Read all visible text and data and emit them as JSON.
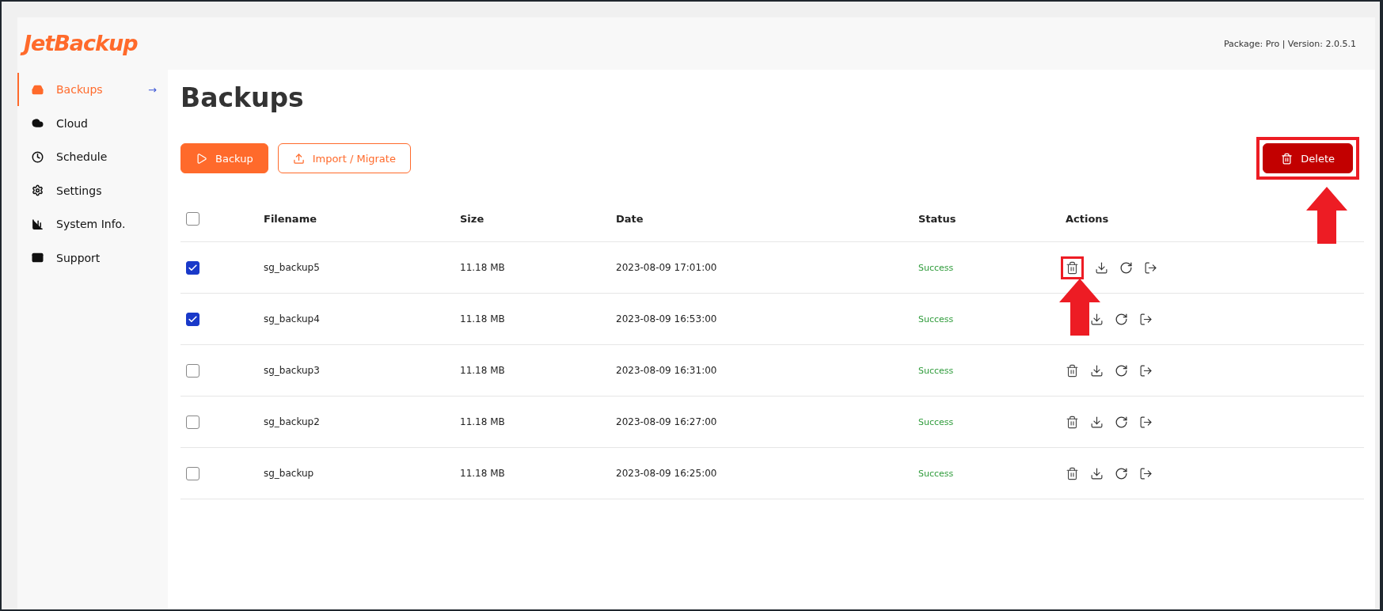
{
  "logo": "JetBackup",
  "header_info": "Package: Pro | Version: 2.0.5.1",
  "sidebar": {
    "items": [
      {
        "label": "Backups",
        "selected": true
      },
      {
        "label": "Cloud",
        "selected": false
      },
      {
        "label": "Schedule",
        "selected": false
      },
      {
        "label": "Settings",
        "selected": false
      },
      {
        "label": "System Info.",
        "selected": false
      },
      {
        "label": "Support",
        "selected": false
      }
    ],
    "active_marker": "→"
  },
  "title": "Backups",
  "toolbar": {
    "backup": "Backup",
    "import": "Import / Migrate",
    "delete": {
      "label": "Delete",
      "highlighted": true
    }
  },
  "table": {
    "select_all": false,
    "columns": [
      "Filename",
      "Size",
      "Date",
      "Status",
      "Actions"
    ],
    "rows": [
      {
        "filename": "sg_backup5",
        "size": "11.18 MB",
        "date": "2023-08-09 17:01:00",
        "status": "Success",
        "checked": true,
        "delete_highlighted": true
      },
      {
        "filename": "sg_backup4",
        "size": "11.18 MB",
        "date": "2023-08-09 16:53:00",
        "status": "Success",
        "checked": true,
        "delete_highlighted": false
      },
      {
        "filename": "sg_backup3",
        "size": "11.18 MB",
        "date": "2023-08-09 16:31:00",
        "status": "Success",
        "checked": false,
        "delete_highlighted": false
      },
      {
        "filename": "sg_backup2",
        "size": "11.18 MB",
        "date": "2023-08-09 16:27:00",
        "status": "Success",
        "checked": false,
        "delete_highlighted": false
      },
      {
        "filename": "sg_backup",
        "size": "11.18 MB",
        "date": "2023-08-09 16:25:00",
        "status": "Success",
        "checked": false,
        "delete_highlighted": false
      }
    ]
  }
}
